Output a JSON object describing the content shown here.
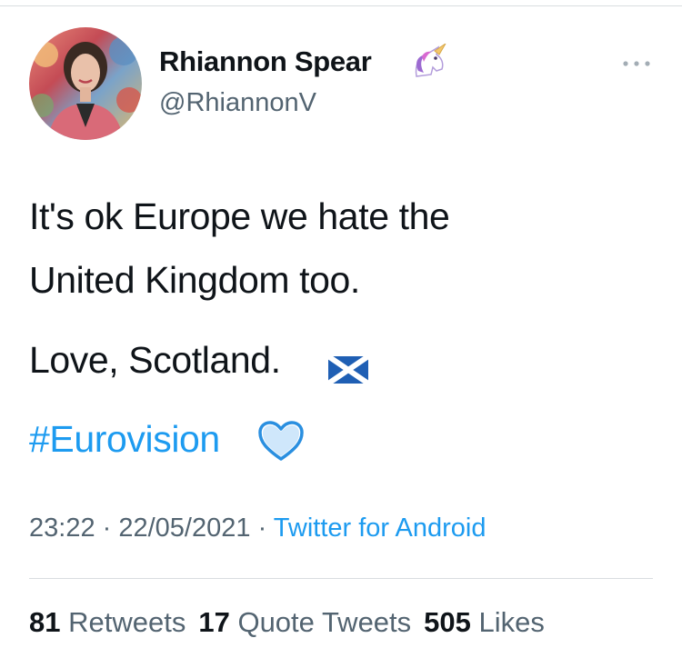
{
  "user": {
    "display_name": "Rhiannon Spear",
    "handle": "@RhiannonV",
    "name_emoji": "unicorn-emoji",
    "avatar": "profile-photo"
  },
  "header": {
    "more_icon": "more-horizontal-icon"
  },
  "tweet": {
    "line1": "It's ok Europe we hate the",
    "line2": "United Kingdom too.",
    "line3": "Love, Scotland.",
    "line3_emoji": "scotland-flag-emoji",
    "hashtag": "#Eurovision",
    "hashtag_emoji": "blue-heart-emoji"
  },
  "meta": {
    "time": "23:22",
    "separator": " · ",
    "date": "22/05/2021",
    "source": "Twitter for Android"
  },
  "stats": {
    "retweets_count": "81",
    "retweets_label": "Retweets",
    "quotes_count": "17",
    "quotes_label": "Quote Tweets",
    "likes_count": "505",
    "likes_label": "Likes"
  },
  "colors": {
    "link": "#1d9bf0",
    "secondary_text": "#536471",
    "primary_text": "#0f1419",
    "divider": "#d9dde0"
  }
}
